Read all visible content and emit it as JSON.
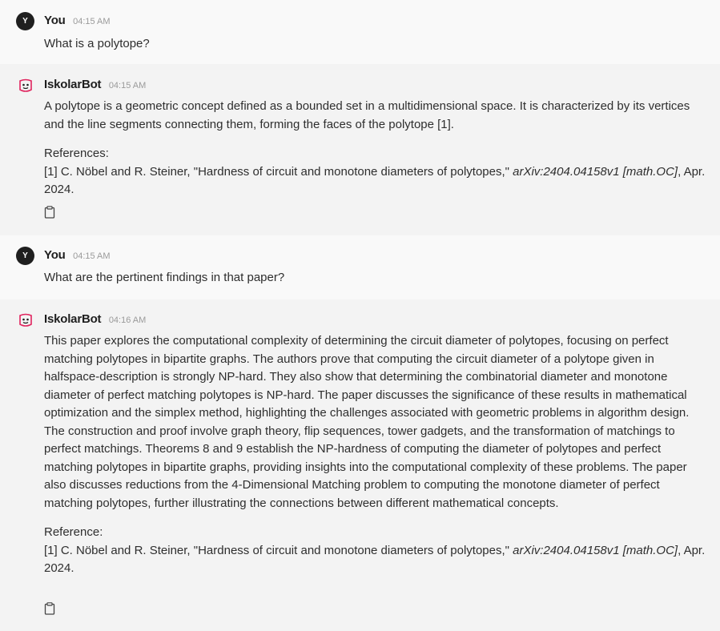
{
  "messages": [
    {
      "sender": "You",
      "avatar": "Y",
      "time": "04:15 AM",
      "text": "What is a polytope?"
    },
    {
      "sender": "IskolarBot",
      "time": "04:15 AM",
      "text": "A polytope is a geometric concept defined as a bounded set in a multidimensional space. It is characterized by its vertices and the line segments connecting them, forming the faces of the polytope [1].",
      "references_label": "References:",
      "reference": {
        "prefix": "[1] C. Nöbel and R. Steiner, \"Hardness of circuit and monotone diameters of polytopes,\" ",
        "venue": "arXiv:2404.04158v1 [math.OC]",
        "suffix": ", Apr. 2024."
      },
      "copy_icon": "clipboard-icon"
    },
    {
      "sender": "You",
      "avatar": "Y",
      "time": "04:15 AM",
      "text": "What are the pertinent findings in that paper?"
    },
    {
      "sender": "IskolarBot",
      "time": "04:16 AM",
      "text": "This paper explores the computational complexity of determining the circuit diameter of polytopes, focusing on perfect matching polytopes in bipartite graphs. The authors prove that computing the circuit diameter of a polytope given in halfspace-description is strongly NP-hard. They also show that determining the combinatorial diameter and monotone diameter of perfect matching polytopes is NP-hard. The paper discusses the significance of these results in mathematical optimization and the simplex method, highlighting the challenges associated with geometric problems in algorithm design. The construction and proof involve graph theory, flip sequences, tower gadgets, and the transformation of matchings to perfect matchings. Theorems 8 and 9 establish the NP-hardness of computing the diameter of polytopes and perfect matching polytopes in bipartite graphs, providing insights into the computational complexity of these problems. The paper also discusses reductions from the 4-Dimensional Matching problem to computing the monotone diameter of perfect matching polytopes, further illustrating the connections between different mathematical concepts.",
      "references_label": "Reference:",
      "reference": {
        "prefix": "[1] C. Nöbel and R. Steiner, \"Hardness of circuit and monotone diameters of polytopes,\" ",
        "venue": "arXiv:2404.04158v1 [math.OC]",
        "suffix": ", Apr. 2024."
      },
      "copy_icon": "clipboard-icon"
    }
  ],
  "colors": {
    "user_bg": "#f9f9f9",
    "bot_bg": "#f3f3f3",
    "avatar_user": "#1f1f1f",
    "bot_avatar_accent": "#e0245e"
  }
}
